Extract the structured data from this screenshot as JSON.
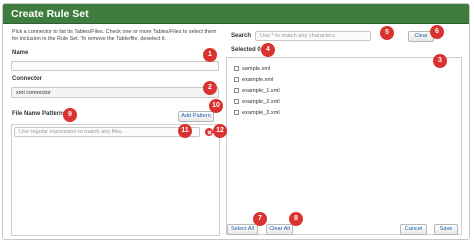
{
  "dialog": {
    "title": "Create Rule Set",
    "intro": "Pick a connector to list its Tables/Files. Check one or more Tables/Files to select them for inclusion in the Rule Set. To remove the Table/file, deselect it."
  },
  "name_field": {
    "label": "Name",
    "value": "",
    "placeholder": ""
  },
  "connector": {
    "label": "Connector",
    "value": "xml connector"
  },
  "patterns": {
    "label": "File Name Patterns",
    "add_label": "Add Pattern",
    "input_placeholder": "Use regular expression to match any files."
  },
  "search": {
    "label": "Search",
    "placeholder": "Use * to match any characters.",
    "clear_label": "Clear"
  },
  "selected": {
    "label": "Selected",
    "count": "0"
  },
  "files": [
    "sample.xml",
    "example.xml",
    "example_1.xml",
    "example_2.xml",
    "example_3.xml"
  ],
  "footer": {
    "select_all": "Select All",
    "clear_all": "Clear All",
    "cancel": "Cancel",
    "save": "Save"
  },
  "callouts": [
    "1",
    "2",
    "3",
    "4",
    "5",
    "6",
    "7",
    "8",
    "9",
    "10",
    "11",
    "12"
  ],
  "colors": {
    "title_bar": "#3e7d3e",
    "badge": "#d9322f",
    "link_text": "#1c5fa8"
  }
}
